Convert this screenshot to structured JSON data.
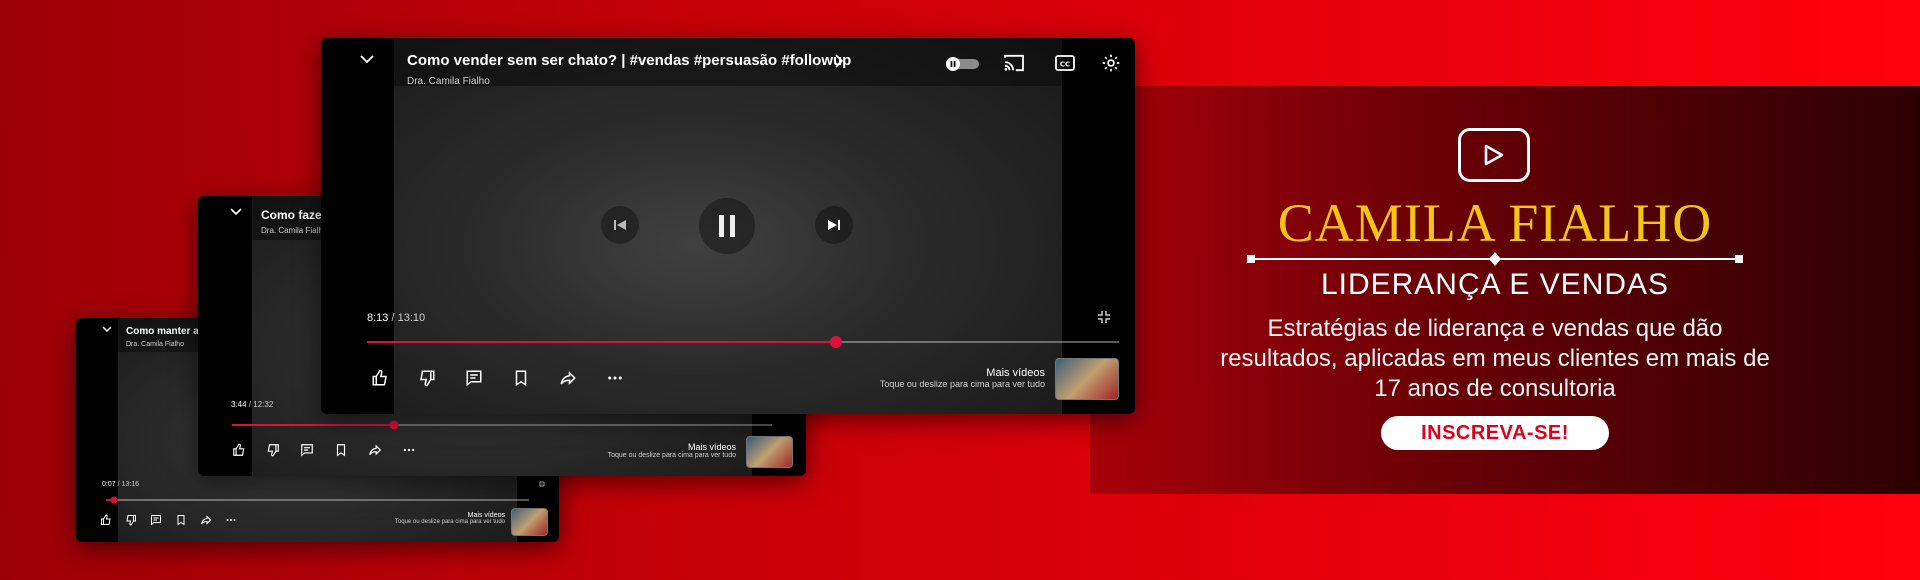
{
  "players": {
    "back": {
      "title": "Como manter a m",
      "channel": "Dra. Camila Fialho",
      "time_current": "0:07",
      "time_total": "13:16",
      "progress": 0.02,
      "more_title": "Mais vídeos",
      "more_hint": "Toque ou deslize para cima para ver tudo"
    },
    "middle": {
      "title": "Como fazer",
      "channel": "Dra. Camila Fialho",
      "time_current": "3:44",
      "time_total": "12:32",
      "progress": 0.3,
      "more_title": "Mais vídeos",
      "more_hint": "Toque ou deslize para cima para ver tudo"
    },
    "front": {
      "title": "Como vender sem ser chato? | #vendas #persuasão #followup",
      "channel": "Dra. Camila Fialho",
      "time_current": "8:13",
      "time_total": "13:10",
      "progress": 0.624,
      "more_title": "Mais vídeos",
      "more_hint": "Toque ou deslize para cima para ver tudo"
    }
  },
  "time_separator": " / ",
  "brand": {
    "name": "CAMILA FIALHO",
    "subtitle": "LIDERANÇA E VENDAS",
    "description": "Estratégias de liderança e vendas que dão resultados, aplicadas em meus clientes em mais de 17 anos de consultoria",
    "cta": "INSCREVA-SE!",
    "name_color": "#f5c418",
    "cta_text_color": "#e0001a"
  },
  "colors": {
    "progress": "#e0103c",
    "background": "#d10008"
  }
}
